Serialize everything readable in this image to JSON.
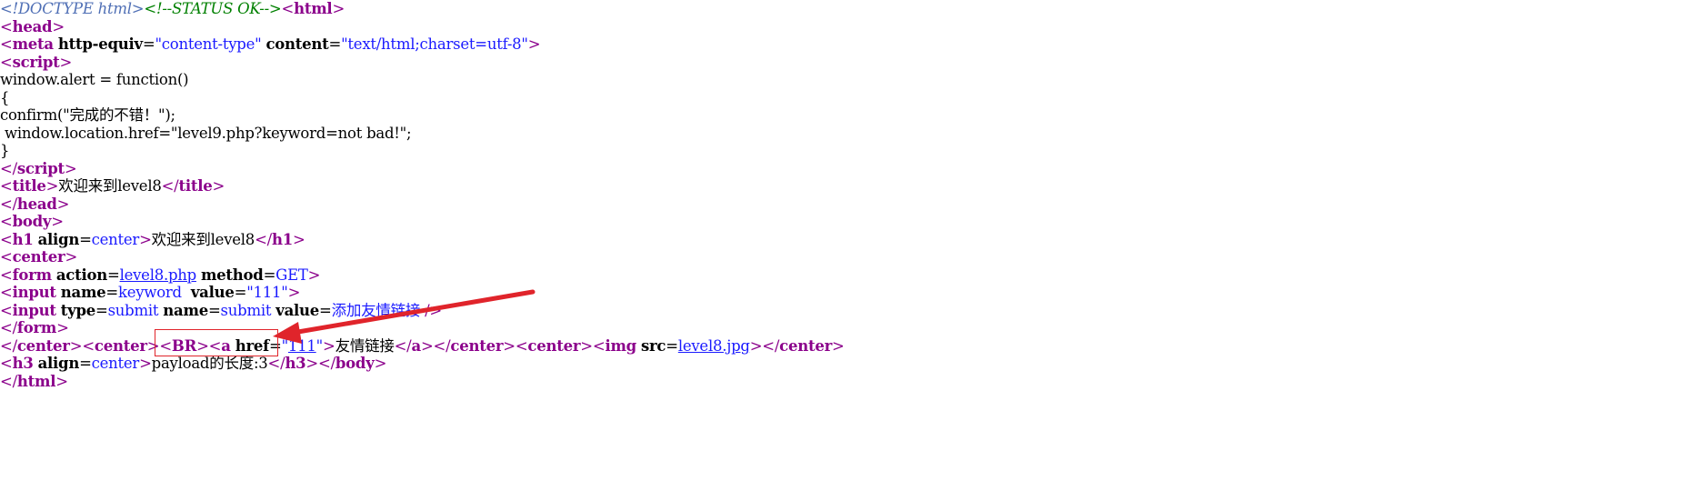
{
  "source_lines": [
    [
      [
        "d",
        "<!DOCTYPE html>"
      ],
      [
        "c",
        "<!--STATUS OK-->"
      ],
      [
        "b",
        "<"
      ],
      [
        "n",
        "html"
      ],
      [
        "b",
        ">"
      ]
    ],
    [
      [
        "b",
        "<"
      ],
      [
        "n",
        "head"
      ],
      [
        "b",
        ">"
      ]
    ],
    [
      [
        "b",
        "<"
      ],
      [
        "n",
        "meta"
      ],
      [
        "t",
        " "
      ],
      [
        "a",
        "http-equiv"
      ],
      [
        "t",
        "="
      ],
      [
        "v",
        "\"content-type\""
      ],
      [
        "t",
        " "
      ],
      [
        "a",
        "content"
      ],
      [
        "t",
        "="
      ],
      [
        "v",
        "\"text/html;charset=utf-8\""
      ],
      [
        "b",
        ">"
      ]
    ],
    [
      [
        "b",
        "<"
      ],
      [
        "n",
        "script"
      ],
      [
        "b",
        ">"
      ]
    ],
    [
      [
        "t",
        "window.alert = function()"
      ]
    ],
    [
      [
        "t",
        "{"
      ]
    ],
    [
      [
        "t",
        "confirm(\"完成的不错！\");"
      ]
    ],
    [
      [
        "t",
        " window.location.href=\"level9.php?keyword=not bad!\";"
      ]
    ],
    [
      [
        "t",
        "}"
      ]
    ],
    [
      [
        "b",
        "</"
      ],
      [
        "n",
        "script"
      ],
      [
        "b",
        ">"
      ]
    ],
    [
      [
        "b",
        "<"
      ],
      [
        "n",
        "title"
      ],
      [
        "b",
        ">"
      ],
      [
        "t",
        "欢迎来到level8"
      ],
      [
        "b",
        "</"
      ],
      [
        "n",
        "title"
      ],
      [
        "b",
        ">"
      ]
    ],
    [
      [
        "b",
        "</"
      ],
      [
        "n",
        "head"
      ],
      [
        "b",
        ">"
      ]
    ],
    [
      [
        "b",
        "<"
      ],
      [
        "n",
        "body"
      ],
      [
        "b",
        ">"
      ]
    ],
    [
      [
        "b",
        "<"
      ],
      [
        "n",
        "h1"
      ],
      [
        "t",
        " "
      ],
      [
        "a",
        "align"
      ],
      [
        "t",
        "="
      ],
      [
        "v",
        "center"
      ],
      [
        "b",
        ">"
      ],
      [
        "t",
        "欢迎来到level8"
      ],
      [
        "b",
        "</"
      ],
      [
        "n",
        "h1"
      ],
      [
        "b",
        ">"
      ]
    ],
    [
      [
        "b",
        "<"
      ],
      [
        "n",
        "center"
      ],
      [
        "b",
        ">"
      ]
    ],
    [
      [
        "b",
        "<"
      ],
      [
        "n",
        "form"
      ],
      [
        "t",
        " "
      ],
      [
        "a",
        "action"
      ],
      [
        "t",
        "="
      ],
      [
        "l",
        "level8.php"
      ],
      [
        "t",
        " "
      ],
      [
        "a",
        "method"
      ],
      [
        "t",
        "="
      ],
      [
        "v",
        "GET"
      ],
      [
        "b",
        ">"
      ]
    ],
    [
      [
        "b",
        "<"
      ],
      [
        "n",
        "input"
      ],
      [
        "t",
        " "
      ],
      [
        "a",
        "name"
      ],
      [
        "t",
        "="
      ],
      [
        "v",
        "keyword"
      ],
      [
        "t",
        "  "
      ],
      [
        "a",
        "value"
      ],
      [
        "t",
        "="
      ],
      [
        "v",
        "\"111\""
      ],
      [
        "b",
        ">"
      ]
    ],
    [
      [
        "b",
        "<"
      ],
      [
        "n",
        "input"
      ],
      [
        "t",
        " "
      ],
      [
        "a",
        "type"
      ],
      [
        "t",
        "="
      ],
      [
        "v",
        "submit"
      ],
      [
        "t",
        " "
      ],
      [
        "a",
        "name"
      ],
      [
        "t",
        "="
      ],
      [
        "v",
        "submit"
      ],
      [
        "t",
        " "
      ],
      [
        "a",
        "value"
      ],
      [
        "t",
        "="
      ],
      [
        "v",
        "添加友情链接"
      ],
      [
        "t",
        " "
      ],
      [
        "b",
        "/>"
      ]
    ],
    [
      [
        "b",
        "</"
      ],
      [
        "n",
        "form"
      ],
      [
        "b",
        ">"
      ]
    ],
    [
      [
        "b",
        "</"
      ],
      [
        "n",
        "center"
      ],
      [
        "b",
        ">"
      ],
      [
        "b",
        "<"
      ],
      [
        "n",
        "center"
      ],
      [
        "b",
        ">"
      ],
      [
        "b",
        "<"
      ],
      [
        "n",
        "BR"
      ],
      [
        "b",
        ">"
      ],
      [
        "b",
        "<"
      ],
      [
        "n",
        "a"
      ],
      [
        "t",
        " "
      ],
      [
        "a",
        "href"
      ],
      [
        "t",
        "="
      ],
      [
        "v",
        "\""
      ],
      [
        "l",
        "111"
      ],
      [
        "v",
        "\""
      ],
      [
        "b",
        ">"
      ],
      [
        "t",
        "友情链接"
      ],
      [
        "b",
        "</"
      ],
      [
        "n",
        "a"
      ],
      [
        "b",
        ">"
      ],
      [
        "b",
        "</"
      ],
      [
        "n",
        "center"
      ],
      [
        "b",
        ">"
      ],
      [
        "b",
        "<"
      ],
      [
        "n",
        "center"
      ],
      [
        "b",
        ">"
      ],
      [
        "b",
        "<"
      ],
      [
        "n",
        "img"
      ],
      [
        "t",
        " "
      ],
      [
        "a",
        "src"
      ],
      [
        "t",
        "="
      ],
      [
        "l",
        "level8.jpg"
      ],
      [
        "b",
        ">"
      ],
      [
        "b",
        "</"
      ],
      [
        "n",
        "center"
      ],
      [
        "b",
        ">"
      ]
    ],
    [
      [
        "b",
        "<"
      ],
      [
        "n",
        "h3"
      ],
      [
        "t",
        " "
      ],
      [
        "a",
        "align"
      ],
      [
        "t",
        "="
      ],
      [
        "v",
        "center"
      ],
      [
        "b",
        ">"
      ],
      [
        "t",
        "payload的长度:3"
      ],
      [
        "b",
        "</"
      ],
      [
        "n",
        "h3"
      ],
      [
        "b",
        ">"
      ],
      [
        "b",
        "</"
      ],
      [
        "n",
        "body"
      ],
      [
        "b",
        ">"
      ]
    ],
    [
      [
        "b",
        "</"
      ],
      [
        "n",
        "html"
      ],
      [
        "b",
        ">"
      ]
    ]
  ],
  "annotation": {
    "box_color": "#e0242b",
    "arrow_color": "#e0242b"
  }
}
